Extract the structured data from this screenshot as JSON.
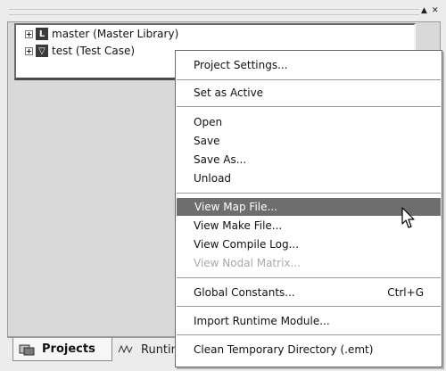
{
  "window": {
    "autohide_icon": "triangle-up-icon",
    "close_icon": "close-icon"
  },
  "tree": {
    "items": [
      {
        "label": "master (Master Library)",
        "icon_letter": "L",
        "icon": "library-icon"
      },
      {
        "label": "test (Test Case)",
        "icon_letter": "▽",
        "icon": "test-case-icon"
      }
    ]
  },
  "context_menu": {
    "project_settings": "Project Settings...",
    "set_as_active": "Set as Active",
    "open": "Open",
    "save": "Save",
    "save_as": "Save As...",
    "unload": "Unload",
    "view_map_file": "View Map File...",
    "view_make_file": "View Make File...",
    "view_compile_log": "View Compile Log...",
    "view_nodal_matrix": "View Nodal Matrix...",
    "global_constants": "Global Constants...",
    "global_constants_shortcut": "Ctrl+G",
    "import_runtime_module": "Import Runtime Module...",
    "clean_temp_dir": "Clean Temporary Directory (.emt)"
  },
  "tabs": {
    "projects": "Projects",
    "runtime": "Runtim"
  },
  "colors": {
    "menu_highlight": "#6e6e6e",
    "disabled_text": "#a8a8a8"
  }
}
